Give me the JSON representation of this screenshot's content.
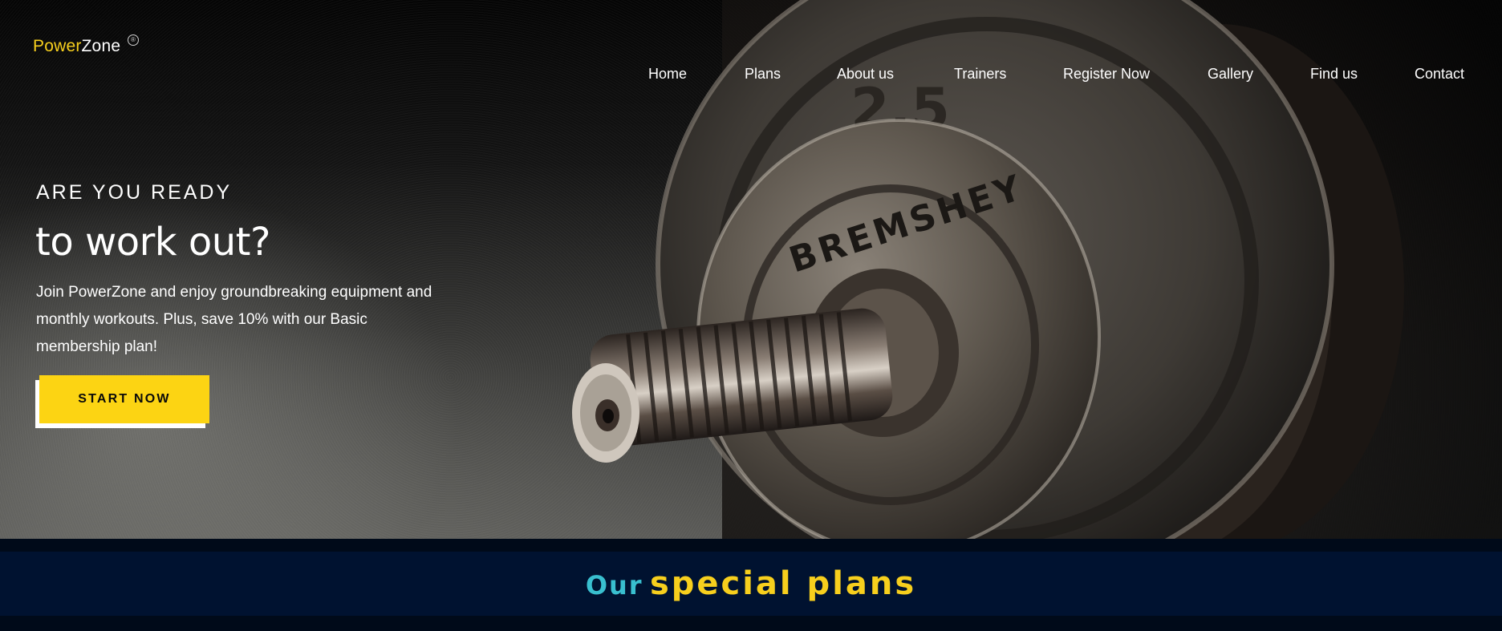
{
  "brand": {
    "name_part1": "Power",
    "name_part2": "Zone",
    "mark": "®"
  },
  "nav": {
    "items": [
      {
        "label": "Home"
      },
      {
        "label": "Plans"
      },
      {
        "label": "About us"
      },
      {
        "label": "Trainers"
      },
      {
        "label": "Register Now"
      },
      {
        "label": "Gallery"
      },
      {
        "label": "Find us"
      },
      {
        "label": "Contact"
      }
    ]
  },
  "hero": {
    "kicker": "ARE YOU READY",
    "headline": "to work out?",
    "blurb": "Join PowerZone and enjoy groundbreaking equipment and monthly workouts. Plus, save 10% with our Basic membership plan!",
    "cta_label": "START NOW",
    "background_icon": "dumbbell-plate-photo"
  },
  "plans_section": {
    "title_part1": "Our",
    "title_part2": "special plans"
  },
  "colors": {
    "brand_yellow": "#fcd413",
    "accent_teal": "#39bfcf",
    "navy_band": "#001230",
    "text_white": "#ffffff"
  }
}
